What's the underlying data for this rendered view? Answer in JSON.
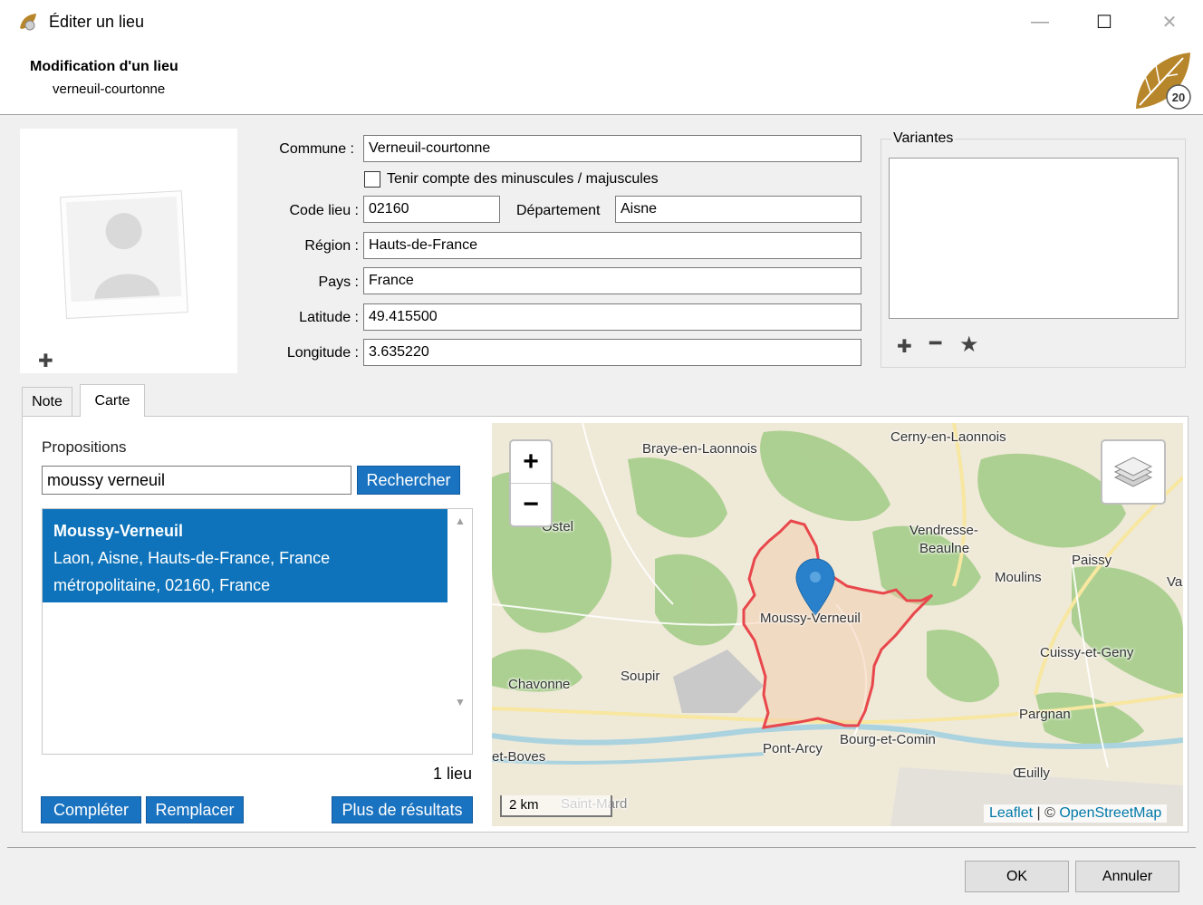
{
  "window": {
    "title": "Éditer un lieu",
    "minimize": "—",
    "maximize": "☐",
    "close": "✕"
  },
  "header": {
    "title": "Modification d'un lieu",
    "subtitle": "verneuil-courtonne",
    "logo_text": "20"
  },
  "form": {
    "commune_label": "Commune :",
    "commune_value": "Verneuil-courtonne",
    "case_checkbox_label": "Tenir compte des minuscules / majuscules",
    "case_checked": false,
    "code_label": "Code lieu :",
    "code_value": "02160",
    "departement_label": "Département",
    "departement_value": "Aisne",
    "region_label": "Région :",
    "region_value": "Hauts-de-France",
    "pays_label": "Pays :",
    "pays_value": "France",
    "latitude_label": "Latitude :",
    "latitude_value": "49.415500",
    "longitude_label": "Longitude :",
    "longitude_value": "3.635220"
  },
  "variantes": {
    "label": "Variantes",
    "items": [],
    "add_icon": "plus-icon",
    "remove_icon": "minus-icon",
    "star_icon": "star-icon"
  },
  "tabs": [
    {
      "label": "Note",
      "active": false
    },
    {
      "label": "Carte",
      "active": true
    }
  ],
  "carte": {
    "propositions_label": "Propositions",
    "search_value": "moussy verneuil",
    "search_button": "Rechercher",
    "results": [
      {
        "title": "Moussy-Verneuil",
        "line1": "Laon, Aisne, Hauts-de-France, France",
        "line2": "métropolitaine, 02160, France"
      }
    ],
    "count": "1 lieu",
    "complete_button": "Compléter",
    "replace_button": "Remplacer",
    "more_button": "Plus de résultats"
  },
  "map": {
    "zoom_in": "+",
    "zoom_out": "−",
    "scale": "2 km",
    "attribution_leaflet": "Leaflet",
    "attribution_sep": " | © ",
    "attribution_osm": "OpenStreetMap",
    "places": {
      "braye": "Braye-en-Laonnois",
      "cerny": "Cerny-en-Laonnois",
      "ostel": "Ostel",
      "vendresse1": "Vendresse-",
      "vendresse2": "Beaulne",
      "paissy": "Paissy",
      "moulins": "Moulins",
      "vassogne": "Va:",
      "moussy": "Moussy-Verneuil",
      "cuissy": "Cuissy-et-Geny",
      "chavonne": "Chavonne",
      "soupir": "Soupir",
      "pargnan": "Pargnan",
      "pontarcy": "Pont-Arcy",
      "bourg": "Bourg-et-Comin",
      "boves": "et-Boves",
      "oeuilly": "Œuilly",
      "saintmard": "Saint-Mard"
    },
    "colors": {
      "base": "#efe9d8",
      "forest": "#a9cf8e",
      "boundary": "#e8474b",
      "marker": "#2a81cb",
      "water": "#aad3df"
    }
  },
  "footer": {
    "ok": "OK",
    "cancel": "Annuler"
  }
}
